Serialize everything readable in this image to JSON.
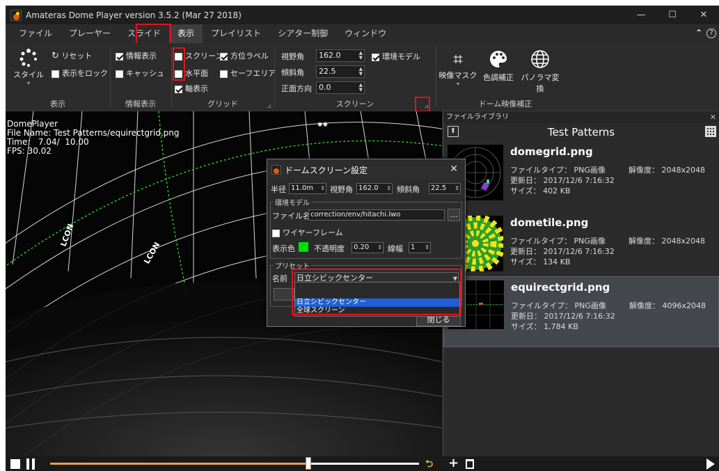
{
  "window": {
    "title": "Amateras Dome Player version 3.5.2 (Mar 27 2018)",
    "controls": {
      "minimize": "—",
      "maximize": "☐",
      "close": "✕"
    }
  },
  "menu": [
    "ファイル",
    "プレーヤー",
    "スライド",
    "表示",
    "プレイリスト",
    "シアター制御",
    "ウィンドウ"
  ],
  "menu_active_index": 3,
  "ribbon": {
    "display": {
      "style_label": "スタイル",
      "reset_label": "リセット",
      "lock_label": "表示をロック",
      "group": "表示"
    },
    "info": {
      "info_display": "情報表示",
      "cache": "キャッシュ",
      "group": "情報表示"
    },
    "grid": {
      "screen": "スクリーン",
      "azimuth": "方位ラベル",
      "horizon": "水平面",
      "safe": "セーフエリア",
      "axis": "軸表示",
      "group": "グリッド"
    },
    "screen": {
      "fov_label": "視野角",
      "fov_value": "162.0",
      "tilt_label": "傾斜角",
      "tilt_value": "22.5",
      "front_label": "正面方向",
      "front_value": "0.0",
      "env_model": "環境モデル",
      "group": "スクリーン"
    },
    "dome": {
      "mask": "映像マスク",
      "color": "色調補正",
      "panorama": "パノラマ変換",
      "group": "ドーム映像補正"
    }
  },
  "osd": {
    "line1": "DomePlayer",
    "line2": "File Name: Test Patterns/equirectgrid.png",
    "line3": "Time:   7.04/  10.00",
    "line4": "FPS: 30.02"
  },
  "library": {
    "header": "ファイルライブラリ",
    "folder": "Test Patterns",
    "items": [
      {
        "name": "domegrid.png",
        "type": "ファイルタイプ： PNG画像",
        "updated": "更新日： 2017/12/6 7:16:32",
        "size": "サイズ： 402 KB",
        "resolution": "解像度： 2048x2048"
      },
      {
        "name": "dometile.png",
        "type": "ファイルタイプ： PNG画像",
        "updated": "更新日： 2017/12/6 7:16:32",
        "size": "サイズ： 134 KB",
        "resolution": "解像度： 2048x2048"
      },
      {
        "name": "equirectgrid.png",
        "type": "ファイルタイプ： PNG画像",
        "updated": "更新日： 2017/12/6 7:16:32",
        "size": "サイズ： 1,784 KB",
        "resolution": "解像度： 4096x2048"
      }
    ],
    "selected_index": 2
  },
  "dialog": {
    "title": "ドームスクリーン設定",
    "radius_label": "半径",
    "radius_value": "11.0m",
    "fov_label": "視野角",
    "fov_value": "162.0",
    "tilt_label": "傾斜角",
    "tilt_value": "22.5",
    "env_group": "環境モデル",
    "file_label": "ファイル名",
    "file_value": "correction/env/hitachi.lwo",
    "browse": "...",
    "wireframe": "ワイヤーフレーム",
    "color_label": "表示色",
    "display_color": "#00e000",
    "opacity_label": "不透明度",
    "opacity_value": "0.20",
    "linewidth_label": "線幅",
    "linewidth_value": "1",
    "preset_group": "プリセット",
    "name_label": "名前",
    "preset_selected": "日立シビックセンター",
    "preset_options": [
      "日立シビックセンター",
      "全球スクリーン"
    ],
    "close": "閉じる"
  },
  "playback": {
    "progress": 0.7
  },
  "colors": {
    "highlight": "#e0141e",
    "accent_orange": "#e8a24a",
    "select_blue": "#1e5fd6",
    "grid_green": "#35d12d"
  }
}
